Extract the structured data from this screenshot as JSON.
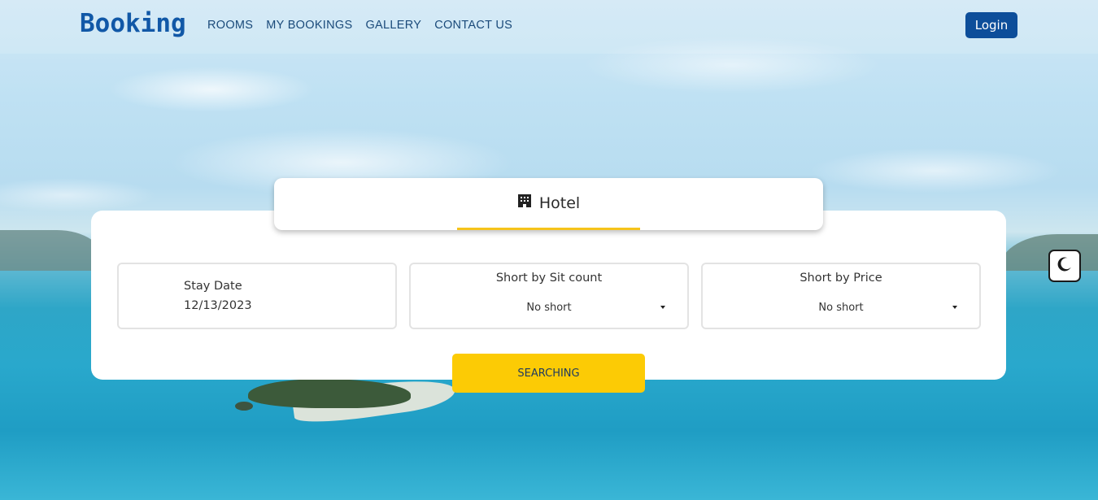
{
  "navbar": {
    "brand": "Booking",
    "links": [
      "ROOMS",
      "MY BOOKINGS",
      "GALLERY",
      "CONTACT US"
    ],
    "login_label": "Login",
    "brand_color": "#1158a7"
  },
  "search": {
    "tab_label": "Hotel",
    "tab_icon": "hotel-building-icon",
    "stay_date_label": "Stay Date",
    "stay_date_value": "12/13/2023",
    "sit_count_label": "Short by Sit count",
    "sit_count_value": "No short",
    "price_label": "Short by Price",
    "price_value": "No short",
    "button_label": "SEARCHING"
  },
  "theme_toggle_icon": "moon-icon",
  "colors": {
    "accent": "#fccb05",
    "login_button": "#0d4e9a"
  }
}
